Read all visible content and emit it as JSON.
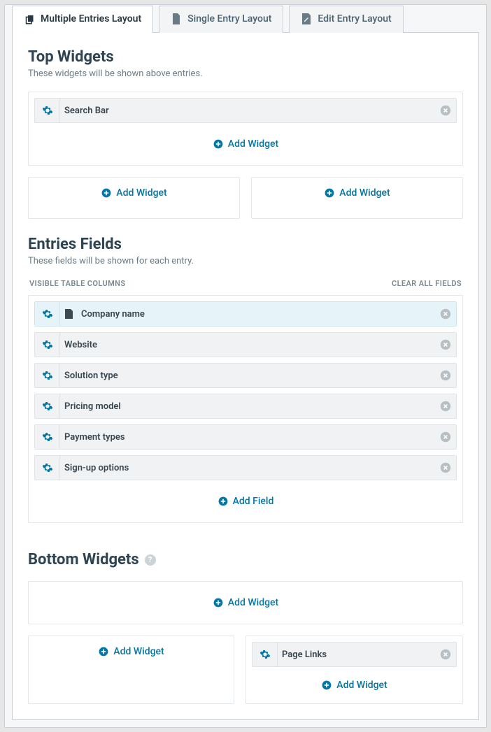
{
  "tabs": {
    "multiple": "Multiple Entries Layout",
    "single": "Single Entry Layout",
    "edit": "Edit Entry Layout"
  },
  "top_widgets": {
    "title": "Top Widgets",
    "desc": "These widgets will be shown above entries.",
    "items": [
      {
        "label": "Search Bar"
      }
    ],
    "add_label": "Add Widget"
  },
  "entries_fields": {
    "title": "Entries Fields",
    "desc": "These fields will be shown for each entry.",
    "visible_label": "VISIBLE TABLE COLUMNS",
    "clear_label": "CLEAR ALL FIELDS",
    "items": [
      {
        "label": "Company name",
        "icon": true
      },
      {
        "label": "Website"
      },
      {
        "label": "Solution type"
      },
      {
        "label": "Pricing model"
      },
      {
        "label": "Payment types"
      },
      {
        "label": "Sign-up options"
      }
    ],
    "add_label": "Add Field"
  },
  "bottom_widgets": {
    "title": "Bottom Widgets",
    "add_label": "Add Widget",
    "right_items": [
      {
        "label": "Page Links"
      }
    ]
  }
}
